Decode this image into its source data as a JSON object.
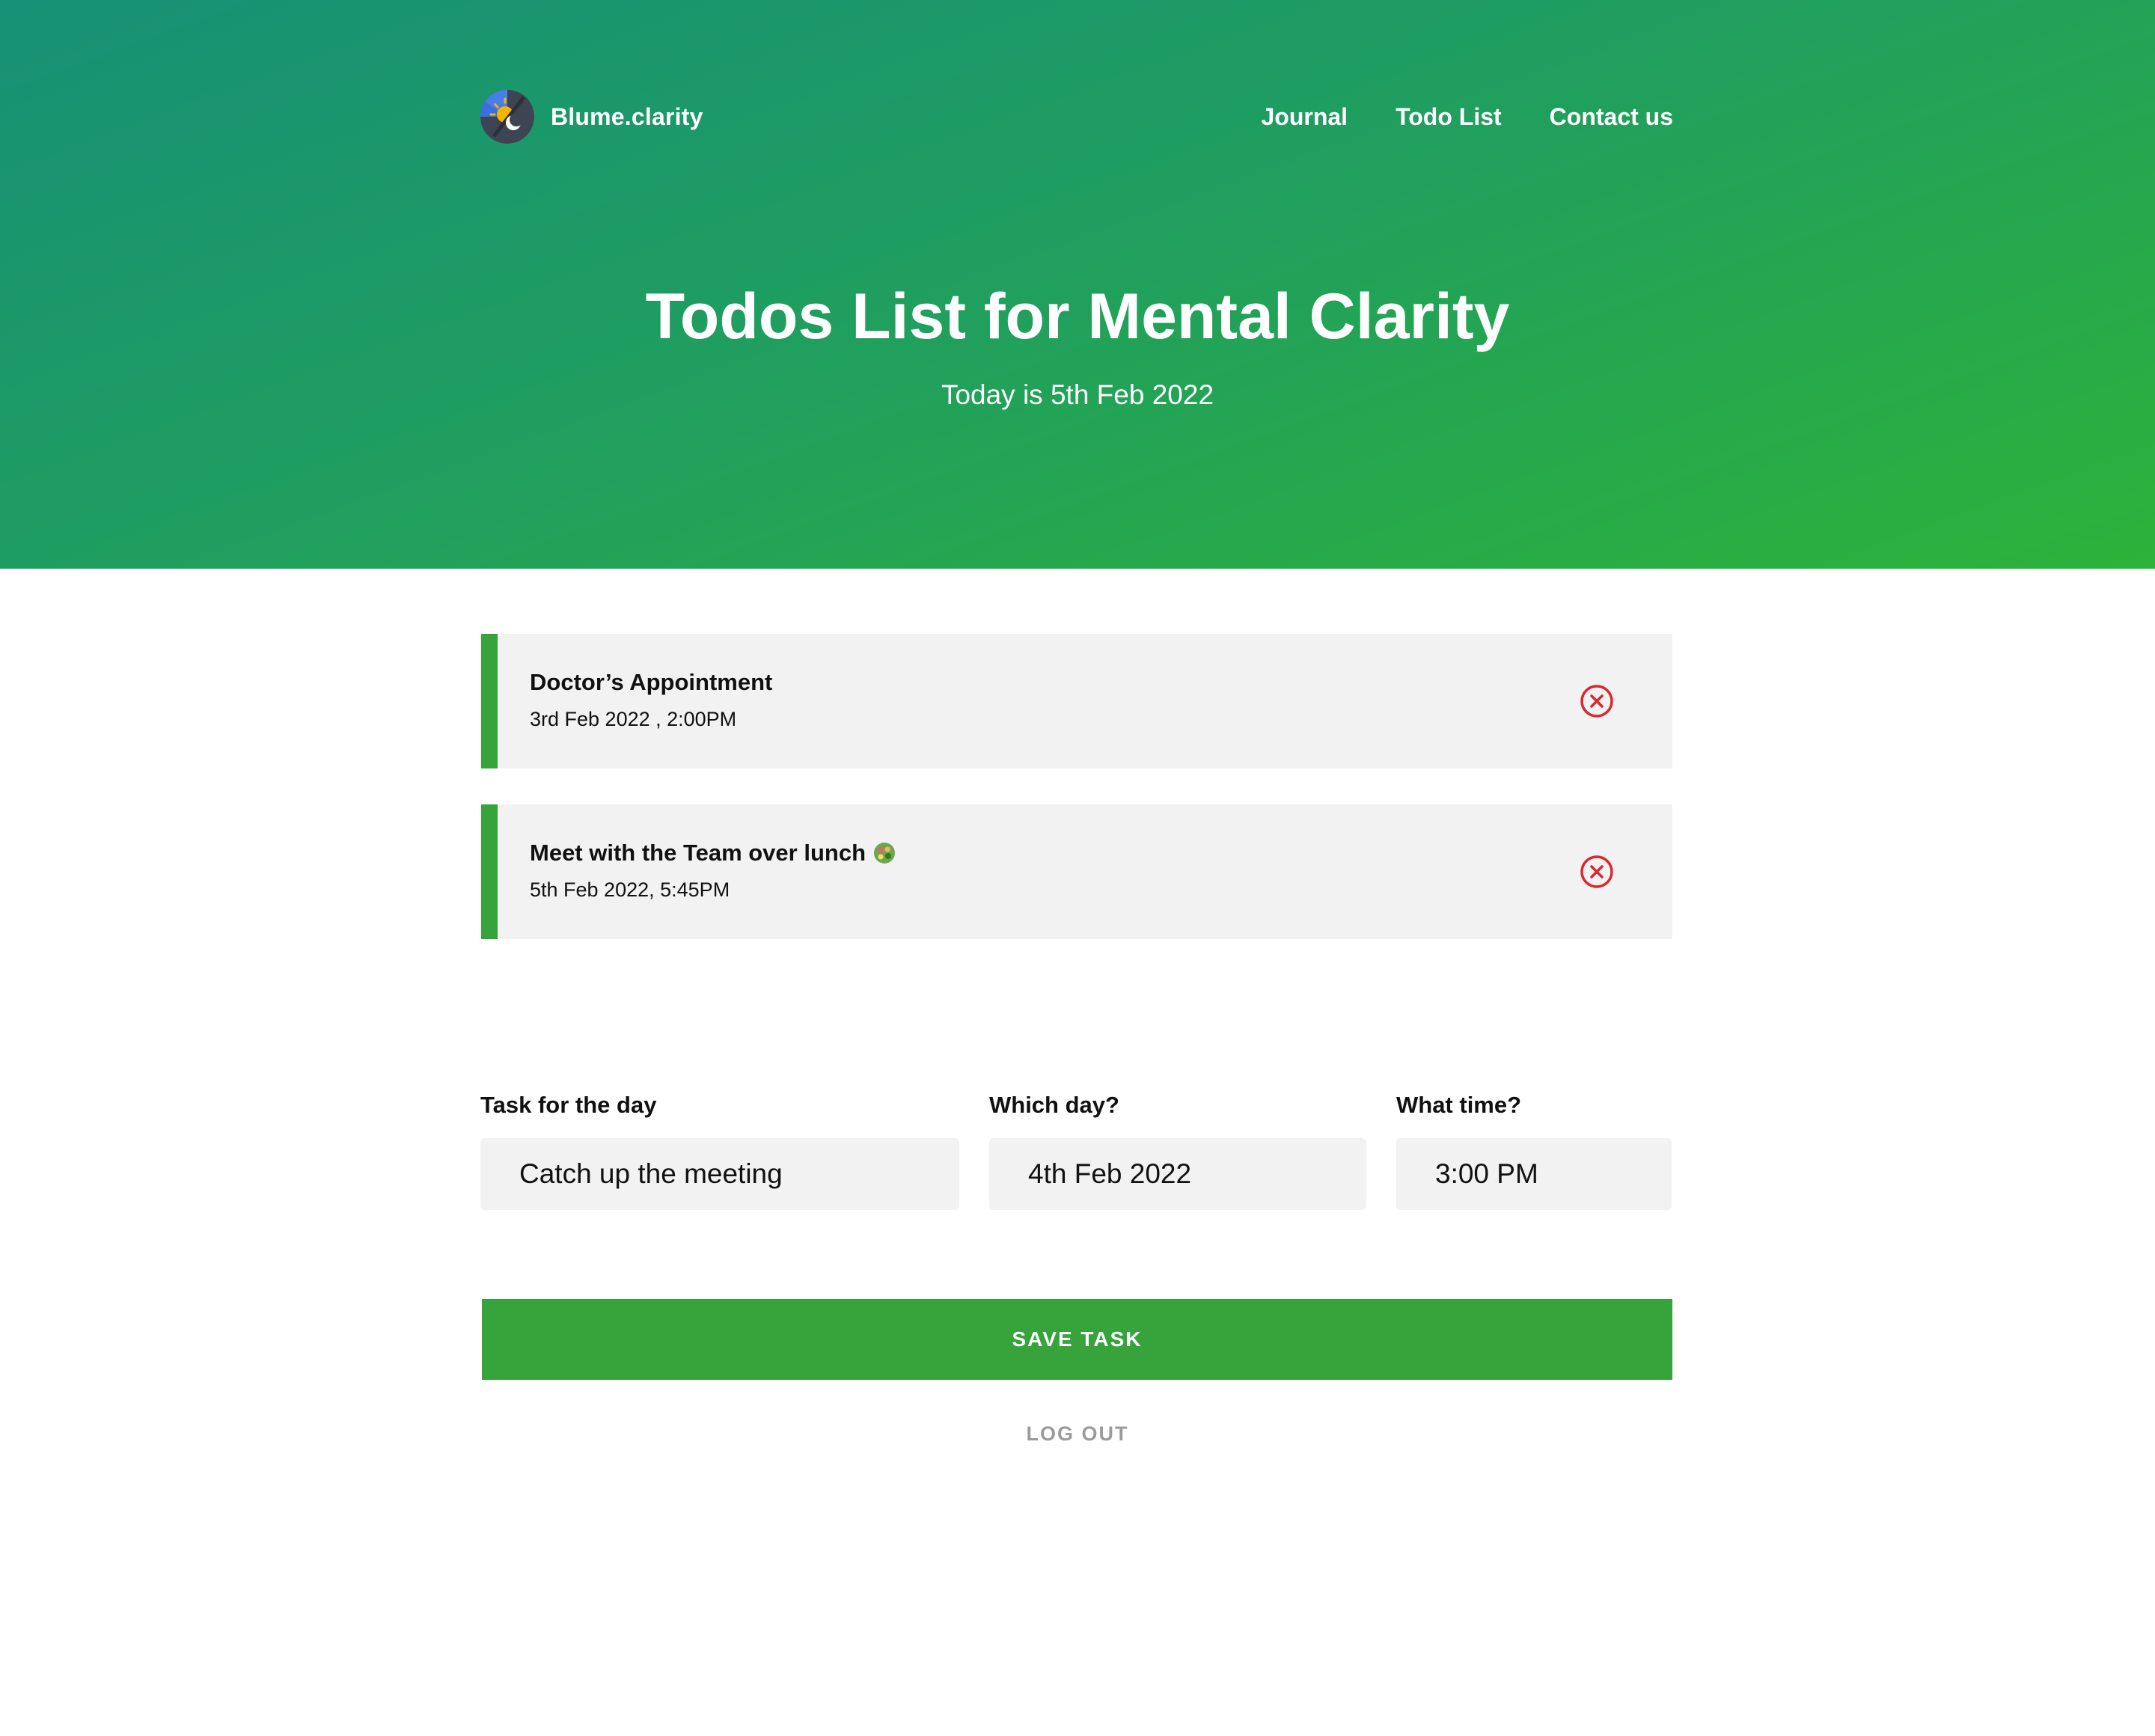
{
  "app": {
    "brand_name": "Blume.clarity",
    "logo_icon": "sun-moon-icon"
  },
  "nav": {
    "items": [
      {
        "label": "Journal"
      },
      {
        "label": "Todo List"
      },
      {
        "label": "Contact us"
      }
    ]
  },
  "hero": {
    "title": "Todos List for Mental Clarity",
    "subtitle": "Today is 5th Feb 2022"
  },
  "todos": [
    {
      "title": "Doctor’s Appointment",
      "datetime": "3rd Feb 2022 , 2:00PM",
      "delete_icon": "close-circle-icon"
    },
    {
      "title": "Meet with the Team over lunch",
      "emoji_icon": "salad-bowl-icon",
      "datetime": "5th Feb 2022, 5:45PM",
      "delete_icon": "close-circle-icon"
    }
  ],
  "form": {
    "task_label": "Task for the day",
    "task_value": "Catch up the meeting",
    "day_label": "Which day?",
    "day_value": "4th Feb 2022",
    "time_label": "What time?",
    "time_value": "3:00 PM",
    "save_label": "SAVE TASK",
    "logout_label": "LOG OUT"
  },
  "colors": {
    "hero_gradient_start": "#179176",
    "hero_gradient_end": "#2db23a",
    "accent_green": "#36a33b",
    "card_background": "#f2f2f2",
    "delete_red": "#d9282f",
    "logout_gray": "#9b9b9b"
  }
}
